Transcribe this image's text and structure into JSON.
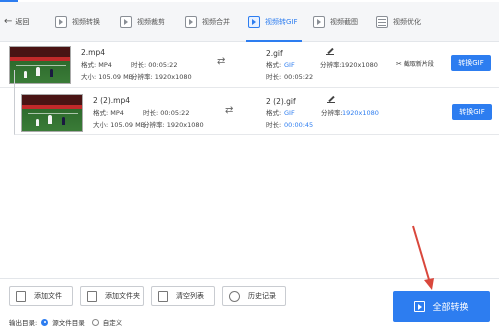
{
  "nav": {
    "back_label": "返回",
    "tabs": [
      {
        "label": "视频转换",
        "active": false
      },
      {
        "label": "视频裁剪",
        "active": false
      },
      {
        "label": "视频合并",
        "active": false
      },
      {
        "label": "视频转GIF",
        "active": true
      },
      {
        "label": "视频截图",
        "active": false
      },
      {
        "label": "视频优化",
        "active": false
      }
    ]
  },
  "files": [
    {
      "name": "2.mp4",
      "format": "格式: MP4",
      "duration": "时长: 00:05:22",
      "size": "大小: 105.09 MB",
      "resolution": "分辨率: 1920x1080",
      "output_name": "2.gif",
      "output_format_label": "格式:",
      "output_format": "GIF",
      "output_duration_label": "时长:",
      "output_duration": "00:05:22",
      "output_resolution_label": "分辨率:",
      "output_resolution": "1920x1080",
      "clip_label": "截取新片段",
      "convert_label": "转换GIF"
    },
    {
      "name": "2 (2).mp4",
      "format": "格式: MP4",
      "duration": "时长: 00:05:22",
      "size": "大小: 105.09 MB",
      "resolution": "分辨率: 1920x1080",
      "output_name": "2 (2).gif",
      "output_format_label": "格式:",
      "output_format": "GIF",
      "output_duration_label": "时长:",
      "output_duration": "00:00:45",
      "output_resolution_label": "分辨率:",
      "output_resolution": "1920x1080",
      "convert_label": "转换GIF"
    }
  ],
  "toolbar": {
    "add_file": "添加文件",
    "add_folder": "添加文件夹",
    "clear_list": "清空列表",
    "history": "历史记录"
  },
  "output": {
    "label": "输出目录:",
    "option_source": "源文件目录",
    "option_custom": "自定义",
    "selected": "源文件目录"
  },
  "convert_all_label": "全部转换",
  "colors": {
    "accent": "#2d7df0",
    "annotation_arrow": "#d9473c"
  }
}
